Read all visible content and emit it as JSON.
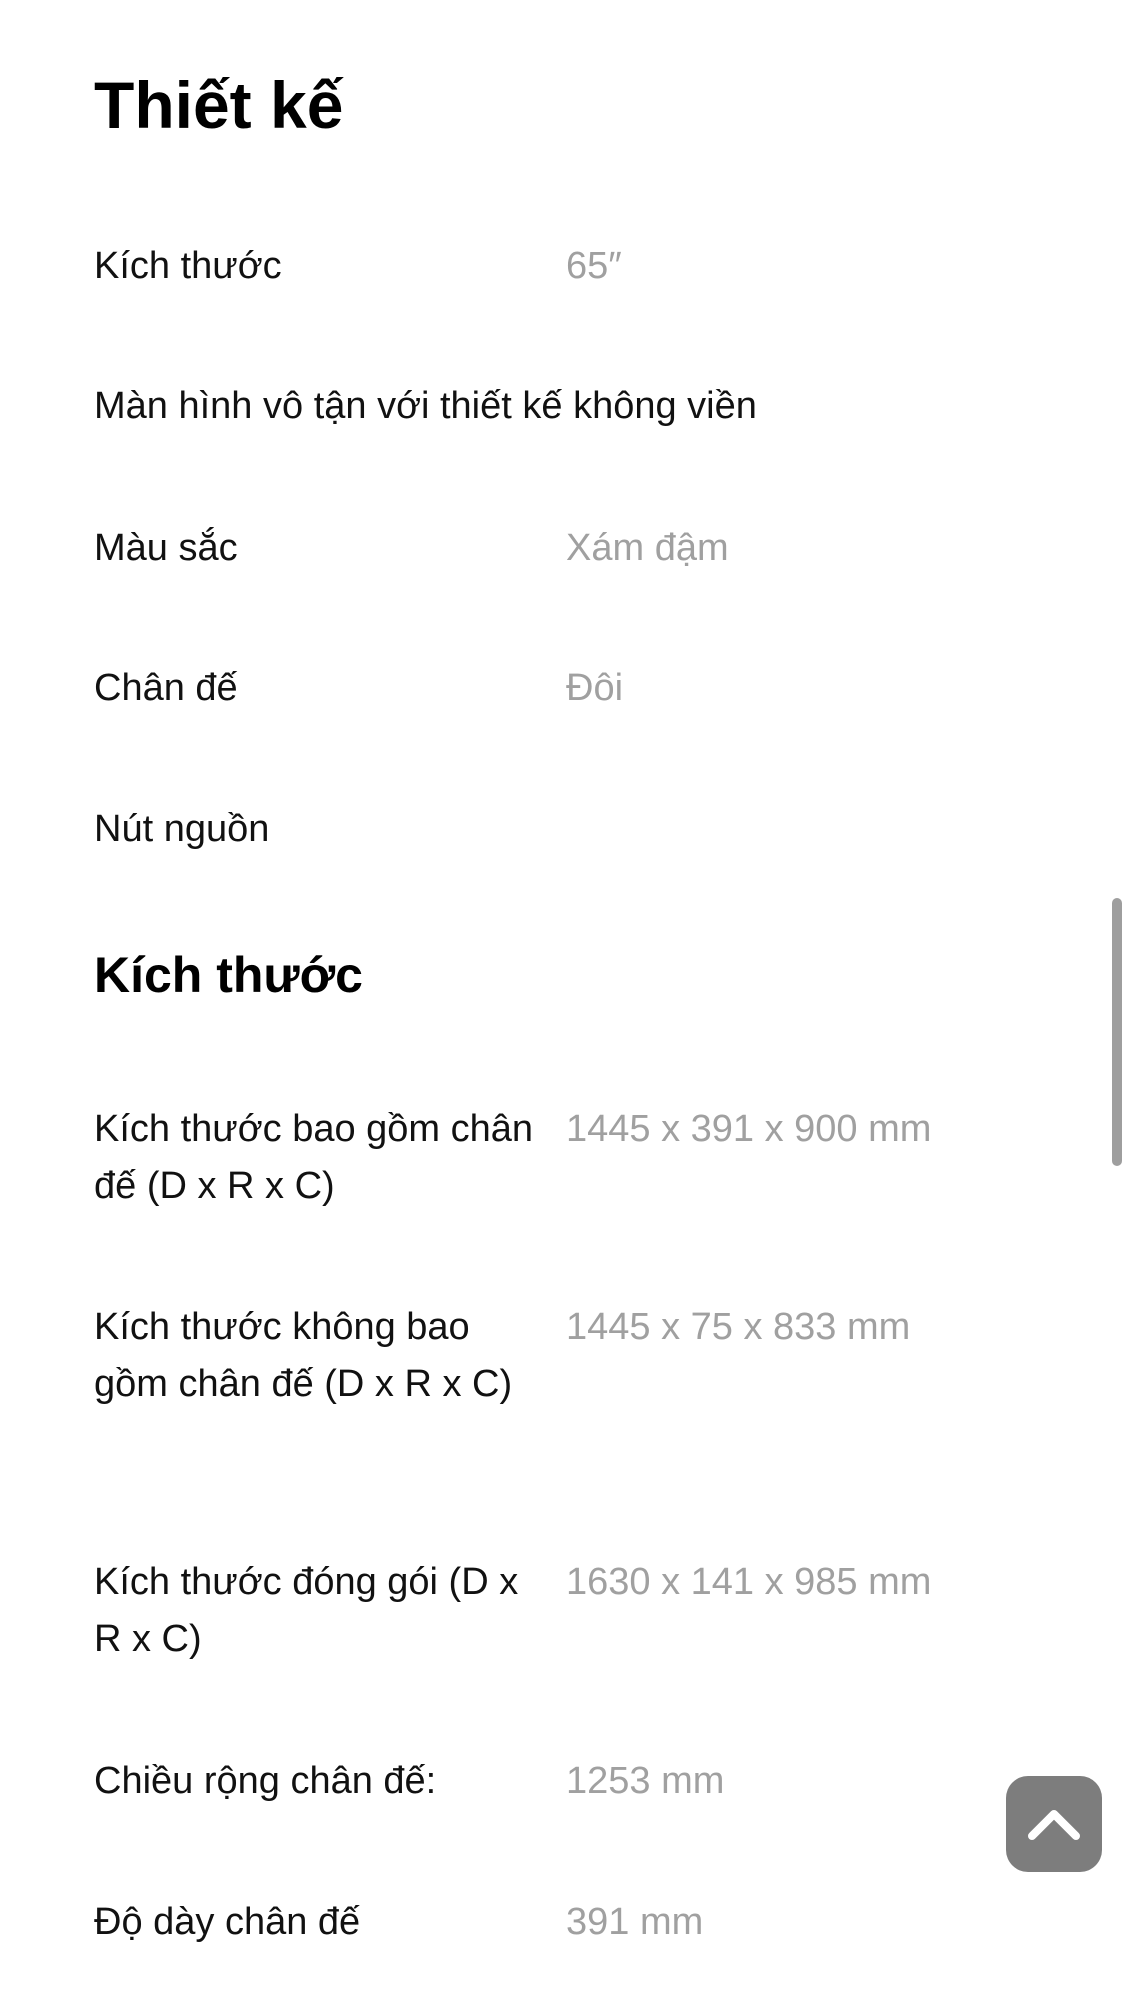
{
  "design": {
    "title": "Thiết kế",
    "rows": [
      {
        "label": "Kích thước",
        "value": "65″"
      },
      {
        "label": "Màn hình vô tận với thiết kế không viền",
        "value": ""
      },
      {
        "label": "Màu sắc",
        "value": "Xám đậm"
      },
      {
        "label": "Chân đế",
        "value": "Đôi"
      },
      {
        "label": "Nút nguồn",
        "value": ""
      }
    ]
  },
  "dimensions": {
    "title": "Kích thước",
    "rows": [
      {
        "label": "Kích thước bao gồm chân đế (D x R x C)",
        "value": "1445 x 391 x 900 mm"
      },
      {
        "label": "Kích thước không bao gồm chân đế (D x R x C)",
        "value": "1445 x 75 x 833 mm"
      },
      {
        "label": "Kích thước đóng gói (D x R x C)",
        "value": "1630 x 141 x 985 mm"
      },
      {
        "label": "Chiều rộng chân đế:",
        "value": "1253 mm"
      },
      {
        "label": "Độ dày chân đế",
        "value": "391 mm"
      }
    ]
  },
  "back_to_top": {
    "icon": "chevron-up-icon",
    "color": "#7d7d7d"
  },
  "scrollbar": {
    "color": "#9e9e9e"
  }
}
